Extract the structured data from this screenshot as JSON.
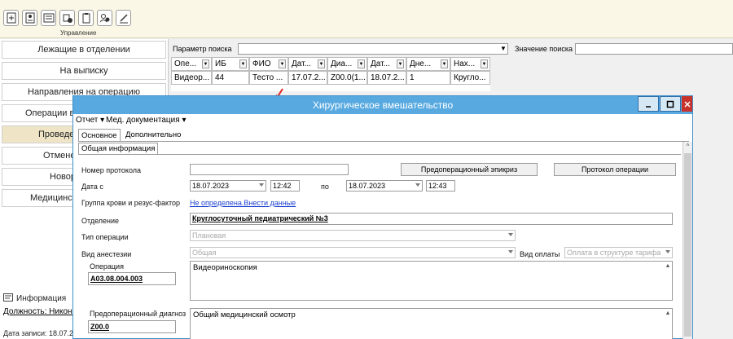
{
  "ribbon": {
    "group_label": "Управление",
    "icons": [
      "add-doc-icon",
      "id-card-icon",
      "list-icon",
      "transfer-icon",
      "clipboard-icon",
      "users-icon",
      "sign-pen-icon"
    ]
  },
  "sidebar": {
    "items": [
      {
        "label": "Лежащие в отделении"
      },
      {
        "label": "На выписку"
      },
      {
        "label": "Направления на операцию"
      },
      {
        "label": "Операции в"
      },
      {
        "label": "Проведен"
      },
      {
        "label": "Отменен"
      },
      {
        "label": "Новор"
      },
      {
        "label": "Медицинск"
      }
    ],
    "info_header": "Информация",
    "position": "Должность: Никонс",
    "record_date": "Дата записи: 18.07.2"
  },
  "search": {
    "param_label": "Параметр поиска",
    "value_label": "Значение поиска",
    "param_value": "",
    "search_value": ""
  },
  "grid": {
    "headers": [
      "Опе...",
      "ИБ",
      "ФИО",
      "Дат...",
      "Диа...",
      "Дат...",
      "Дне...",
      "Нах..."
    ],
    "rows": [
      [
        "Видеор...",
        "44",
        "Тесто ...",
        "17.07.2...",
        "Z00.0(1...",
        "18.07.2...",
        "1",
        "Кругло..."
      ]
    ]
  },
  "dialog": {
    "title": "Хирургическое вмешательство",
    "menu": [
      "Отчет ▾",
      "Мед. документация ▾"
    ],
    "tabs": [
      "Основное",
      "Дополнительно"
    ],
    "subtab": "Общая информация",
    "form": {
      "protocol_number_label": "Номер протокола",
      "protocol_number": "",
      "preop_epicrisis_button": "Предоперационный эпикриз",
      "op_protocol_button": "Протокол операции",
      "date_from_label": "Дата с",
      "date_from": "18.07.2023",
      "time_from": "12:42",
      "to_label": "по",
      "date_to": "18.07.2023",
      "time_to": "12:43",
      "blood_label": "Группа крови и резус-фактор",
      "blood_link": "Не определена.Внести данные",
      "department_label": "Отделение",
      "department_value": "Круглосуточный педиатрический №3",
      "op_type_label": "Тип операции",
      "op_type_value": "Плановая",
      "anesthesia_label": "Вид анестезии",
      "anesthesia_value": "Общая",
      "payment_label": "Вид оплаты",
      "payment_value": "Оплата в структуре тарифа",
      "operation_label": "Операция",
      "operation_code": "A03.08.004.003",
      "operation_text": "Видеориноскопия",
      "diag_label": "Предоперационный диагноз",
      "diag_code": "Z00.0",
      "diag_text": "Общий медицинский осмотр"
    }
  },
  "colors": {
    "titlebar": "#57a9e0",
    "ribbon": "#fbf7e6",
    "active_item": "#efe5c6",
    "close": "#c8322a",
    "link": "#1a3fd0",
    "arrow": "#e0211f"
  }
}
